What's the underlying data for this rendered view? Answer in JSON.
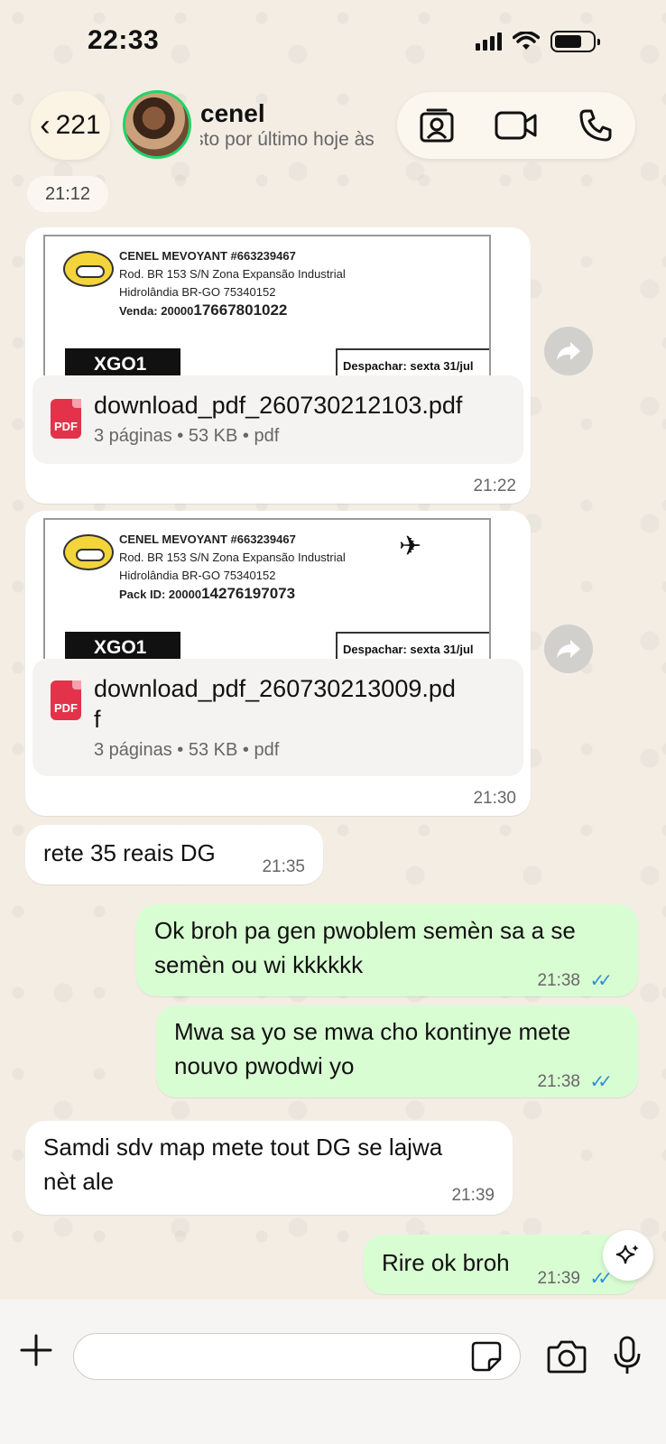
{
  "status_bar": {
    "time": "22:33"
  },
  "header": {
    "back_count": "221",
    "contact_name": "cenel",
    "contact_status": "visto por último hoje às"
  },
  "chat": {
    "date_chip": "21:12",
    "messages": [
      {
        "type": "document",
        "direction": "incoming",
        "preview": {
          "line1": "CENEL MEVOYANT #663239467",
          "line2": "Rod. BR 153 S/N Zona Expansão Industrial",
          "line3": "Hidrolândia BR-GO 75340152",
          "line4_label": "Venda: 20000",
          "line4_value": "17667801022",
          "badge": "XGO1",
          "despachar": "Despachar: sexta 31/jul"
        },
        "file_name": "download_pdf_260730212103.pdf",
        "file_meta": "3 páginas • 53 KB • pdf",
        "time": "21:22",
        "icon_label": "PDF"
      },
      {
        "type": "document",
        "direction": "incoming",
        "preview": {
          "line1": "CENEL MEVOYANT #663239467",
          "line2": "Rod. BR 153 S/N Zona Expansão Industrial",
          "line3": "Hidrolândia BR-GO 75340152",
          "line4_label": "Pack ID: 20000",
          "line4_value": "14276197073",
          "badge": "XGO1",
          "despachar": "Despachar: sexta 31/jul"
        },
        "file_name_line1": "download_pdf_260730213009.pd",
        "file_name_line2": "f",
        "file_meta": "3 páginas • 53 KB • pdf",
        "time": "21:30",
        "icon_label": "PDF"
      },
      {
        "type": "text",
        "direction": "incoming",
        "text": "rete 35 reais DG",
        "time": "21:35"
      },
      {
        "type": "text",
        "direction": "outgoing",
        "line1": "Ok broh pa gen pwoblem semèn sa a se",
        "line2": "semèn ou wi kkkkkk",
        "time": "21:38",
        "ticks": "✓✓"
      },
      {
        "type": "text",
        "direction": "outgoing",
        "line1": "Mwa sa yo se mwa cho kontinye mete",
        "line2": "nouvo pwodwi yo",
        "time": "21:38",
        "ticks": "✓✓"
      },
      {
        "type": "text",
        "direction": "incoming",
        "line1": "Samdi sdv map mete tout DG se lajwa",
        "line2": "nèt ale",
        "time": "21:39"
      },
      {
        "type": "text",
        "direction": "outgoing",
        "text": "Rire ok broh",
        "time": "21:39",
        "ticks": "✓✓"
      }
    ]
  },
  "colors": {
    "outgoing_bubble": "#d9fdd3",
    "incoming_bubble": "#ffffff",
    "read_ticks": "#2d8fd6",
    "pdf_icon": "#e2334a",
    "avatar_ring": "#25d366"
  }
}
